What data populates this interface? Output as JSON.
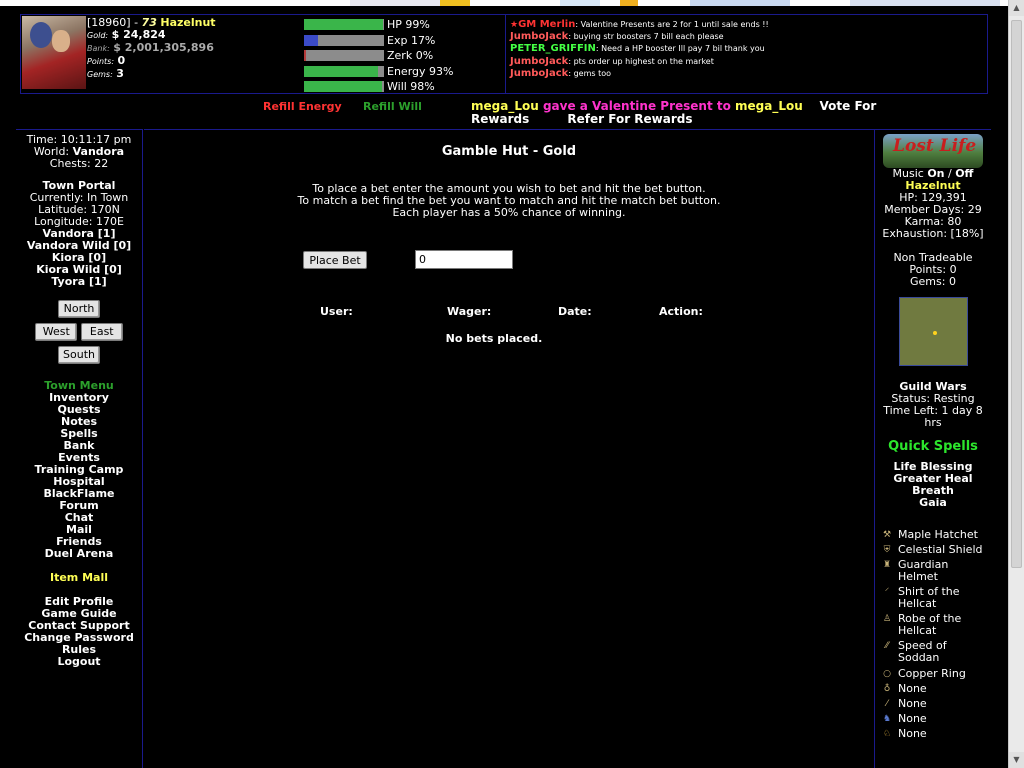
{
  "header": {
    "user_id": "[18960]",
    "separator": " - ",
    "level": "73",
    "username": "Hazelnut",
    "gold_label": "Gold:",
    "gold": "$ 24,824",
    "bank_label": "Bank:",
    "bank": "$ 2,001,305,896",
    "points_label": "Points:",
    "points": "0",
    "gems_label": "Gems:",
    "gems": "3",
    "bars": [
      {
        "label": "HP 99%",
        "fill": 99,
        "color": "#3ab54a"
      },
      {
        "label": "Exp 17%",
        "fill": 17,
        "color": "#3b4bc8"
      },
      {
        "label": "Zerk 0%",
        "fill": 0,
        "color": "#b43b3b"
      },
      {
        "label": "Energy 93%",
        "fill": 93,
        "color": "#3ab54a"
      },
      {
        "label": "Will 98%",
        "fill": 98,
        "color": "#3ab54a"
      }
    ],
    "chat": [
      {
        "who": "GM Merlin",
        "color": "#ff3333",
        "gm": true,
        "msg": " Valentine Presents are 2 for 1 until sale ends !!"
      },
      {
        "who": "JumboJack",
        "color": "#ff5a5a",
        "gm": false,
        "msg": " buying str boosters 7 bill each please"
      },
      {
        "who": "PETER_GRIFFIN",
        "color": "#44ff44",
        "gm": false,
        "msg": " Need a HP booster Ill pay 7 bil thank you"
      },
      {
        "who": "JumboJack",
        "color": "#ff5a5a",
        "gm": false,
        "msg": " pts order up highest on the market"
      },
      {
        "who": "JumboJack",
        "color": "#ff5a5a",
        "gm": false,
        "msg": " gems too"
      }
    ]
  },
  "notices": {
    "refill_energy": "Refill Energy",
    "refill_will": "Refill Will",
    "present_from": "mega_Lou",
    "present_text": " gave a Valentine Present to ",
    "present_to": "mega_Lou",
    "vote_line1": "Vote For",
    "vote_line2": "Rewards",
    "refer": "Refer For Rewards"
  },
  "left": {
    "time": "Time: 10:11:17 pm",
    "world_label": "World: ",
    "world": "Vandora",
    "chests": "Chests: 22",
    "town_portal": "Town Portal",
    "currently": "Currently: In Town",
    "latitude": "Latitude: 170N",
    "longitude": "Longitude: 170E",
    "worlds": [
      "Vandora [1]",
      "Vandora Wild [0]",
      "Kiora [0]",
      "Kiora Wild [0]",
      "Tyora [1]"
    ],
    "dirs": {
      "north": "North",
      "west": "West",
      "east": "East",
      "south": "South"
    },
    "town_menu": "Town Menu",
    "menu": [
      "Inventory",
      "Quests",
      "Notes",
      "Spells",
      "Bank",
      "Events",
      "Training Camp",
      "Hospital",
      "BlackFlame",
      "Forum",
      "Chat",
      "Mail",
      "Friends",
      "Duel Arena"
    ],
    "item_mall": "Item Mall",
    "account": [
      "Edit Profile",
      "Game Guide",
      "Contact Support",
      "Change Password",
      "Rules",
      "Logout"
    ]
  },
  "main": {
    "title": "Gamble Hut - Gold",
    "instr1": "To place a bet enter the amount you wish to bet and hit the bet button.",
    "instr2": "To match a bet find the bet you want to match and hit the match bet button.",
    "instr3": "Each player has a 50% chance of winning.",
    "place_bet": "Place Bet",
    "bet_value": "0",
    "cols": [
      "User:",
      "Wager:",
      "Date:",
      "Action:"
    ],
    "no_bets": "No bets placed."
  },
  "right": {
    "logo_text": "Lost Life",
    "music_label": "Music ",
    "music_on": "On",
    "music_sep": " / ",
    "music_off": "Off",
    "name": "Hazelnut",
    "hp": "HP: 129,391",
    "member_days": "Member Days: 29",
    "karma": "Karma: 80",
    "exhaustion": "Exhaustion: [18%]",
    "non_tradeable": "Non Tradeable",
    "nt_points": "Points: 0",
    "nt_gems": "Gems: 0",
    "guild_wars": "Guild Wars",
    "gw_status": "Status: Resting",
    "gw_time": "Time Left: 1 day 8 hrs",
    "quick_spells": "Quick Spells",
    "spells": [
      "Life Blessing",
      "Greater Heal",
      "Breath",
      "Gaia"
    ],
    "equipment": [
      {
        "name": "Maple Hatchet",
        "icon": "axe-icon"
      },
      {
        "name": "Celestial Shield",
        "icon": "shield-icon"
      },
      {
        "name": "Guardian Helmet",
        "icon": "helmet-icon"
      },
      {
        "name": "Shirt of the Hellcat",
        "icon": "shirt-icon"
      },
      {
        "name": "Robe of the Hellcat",
        "icon": "robe-icon"
      },
      {
        "name": "Speed of Soddan",
        "icon": "boots-icon"
      },
      {
        "name": "Copper Ring",
        "icon": "ring-icon"
      },
      {
        "name": "None",
        "icon": "amulet-icon"
      },
      {
        "name": "None",
        "icon": "wand-icon"
      },
      {
        "name": "None",
        "icon": "pet-icon"
      },
      {
        "name": "None",
        "icon": "mount-icon"
      }
    ]
  }
}
